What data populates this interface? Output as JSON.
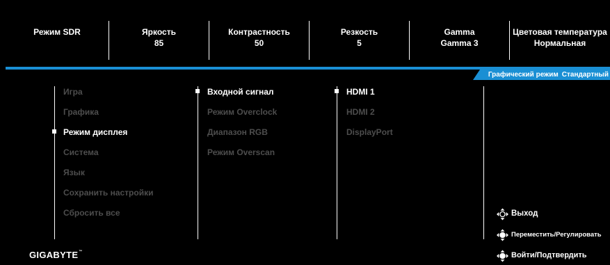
{
  "header": [
    {
      "title": "Режим SDR",
      "value": ""
    },
    {
      "title": "Яркость",
      "value": "85"
    },
    {
      "title": "Контрастность",
      "value": "50"
    },
    {
      "title": "Резкость",
      "value": "5"
    },
    {
      "title": "Gamma",
      "value": "Gamma 3"
    },
    {
      "title": "Цветовая температура",
      "value": "Нормальная"
    }
  ],
  "mode_bar": {
    "label": "Графический режим",
    "value": "Стандартный"
  },
  "menu": {
    "items": [
      "Игра",
      "Графика",
      "Режим дисплея",
      "Система",
      "Язык",
      "Сохранить настройки",
      "Сбросить все"
    ],
    "selected_index": 2
  },
  "submenu": {
    "items": [
      "Входной сигнал",
      "Режим Overclock",
      "Диапазон RGB",
      "Режим Overscan"
    ],
    "selected_index": 0
  },
  "options": {
    "items": [
      "HDMI 1",
      "HDMI 2",
      "DisplayPort"
    ],
    "selected_index": 0
  },
  "hints": {
    "exit": "Выход",
    "move": "Переместить/Регулировать",
    "enter": "Войти/Подтвердить"
  },
  "brand": "GIGABYTE",
  "brand_mark": "™",
  "colors": {
    "accent": "#1a8fd4",
    "background": "#000000",
    "text": "#ffffff",
    "dim_text": "#4d4d4d"
  },
  "icons": {
    "hint_icon": "joystick-icon"
  }
}
